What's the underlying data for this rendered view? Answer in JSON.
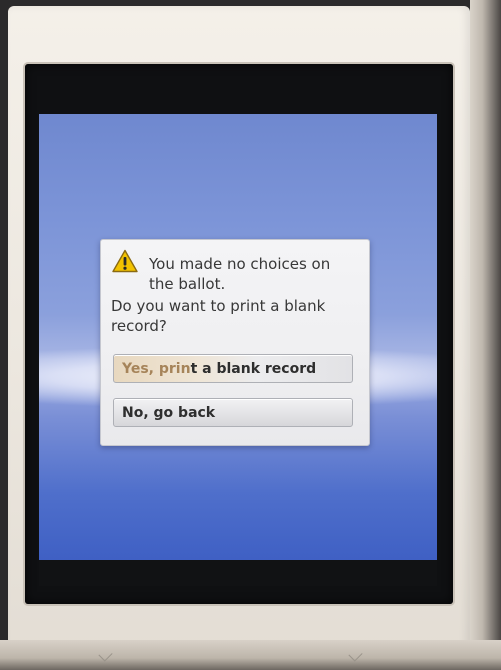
{
  "dialog": {
    "icon": "warning-icon",
    "title": "You made no choices on the ballot.",
    "question": "Do you want to print a blank record?",
    "buttons": {
      "yes_prefix": "Yes, prin",
      "yes_suffix": "t a blank record",
      "no": "No, go back"
    }
  },
  "colors": {
    "screen_blue": "#6f88cf",
    "dialog_bg": "#efeff1",
    "warning_yellow": "#f2c200",
    "text": "#383838"
  }
}
